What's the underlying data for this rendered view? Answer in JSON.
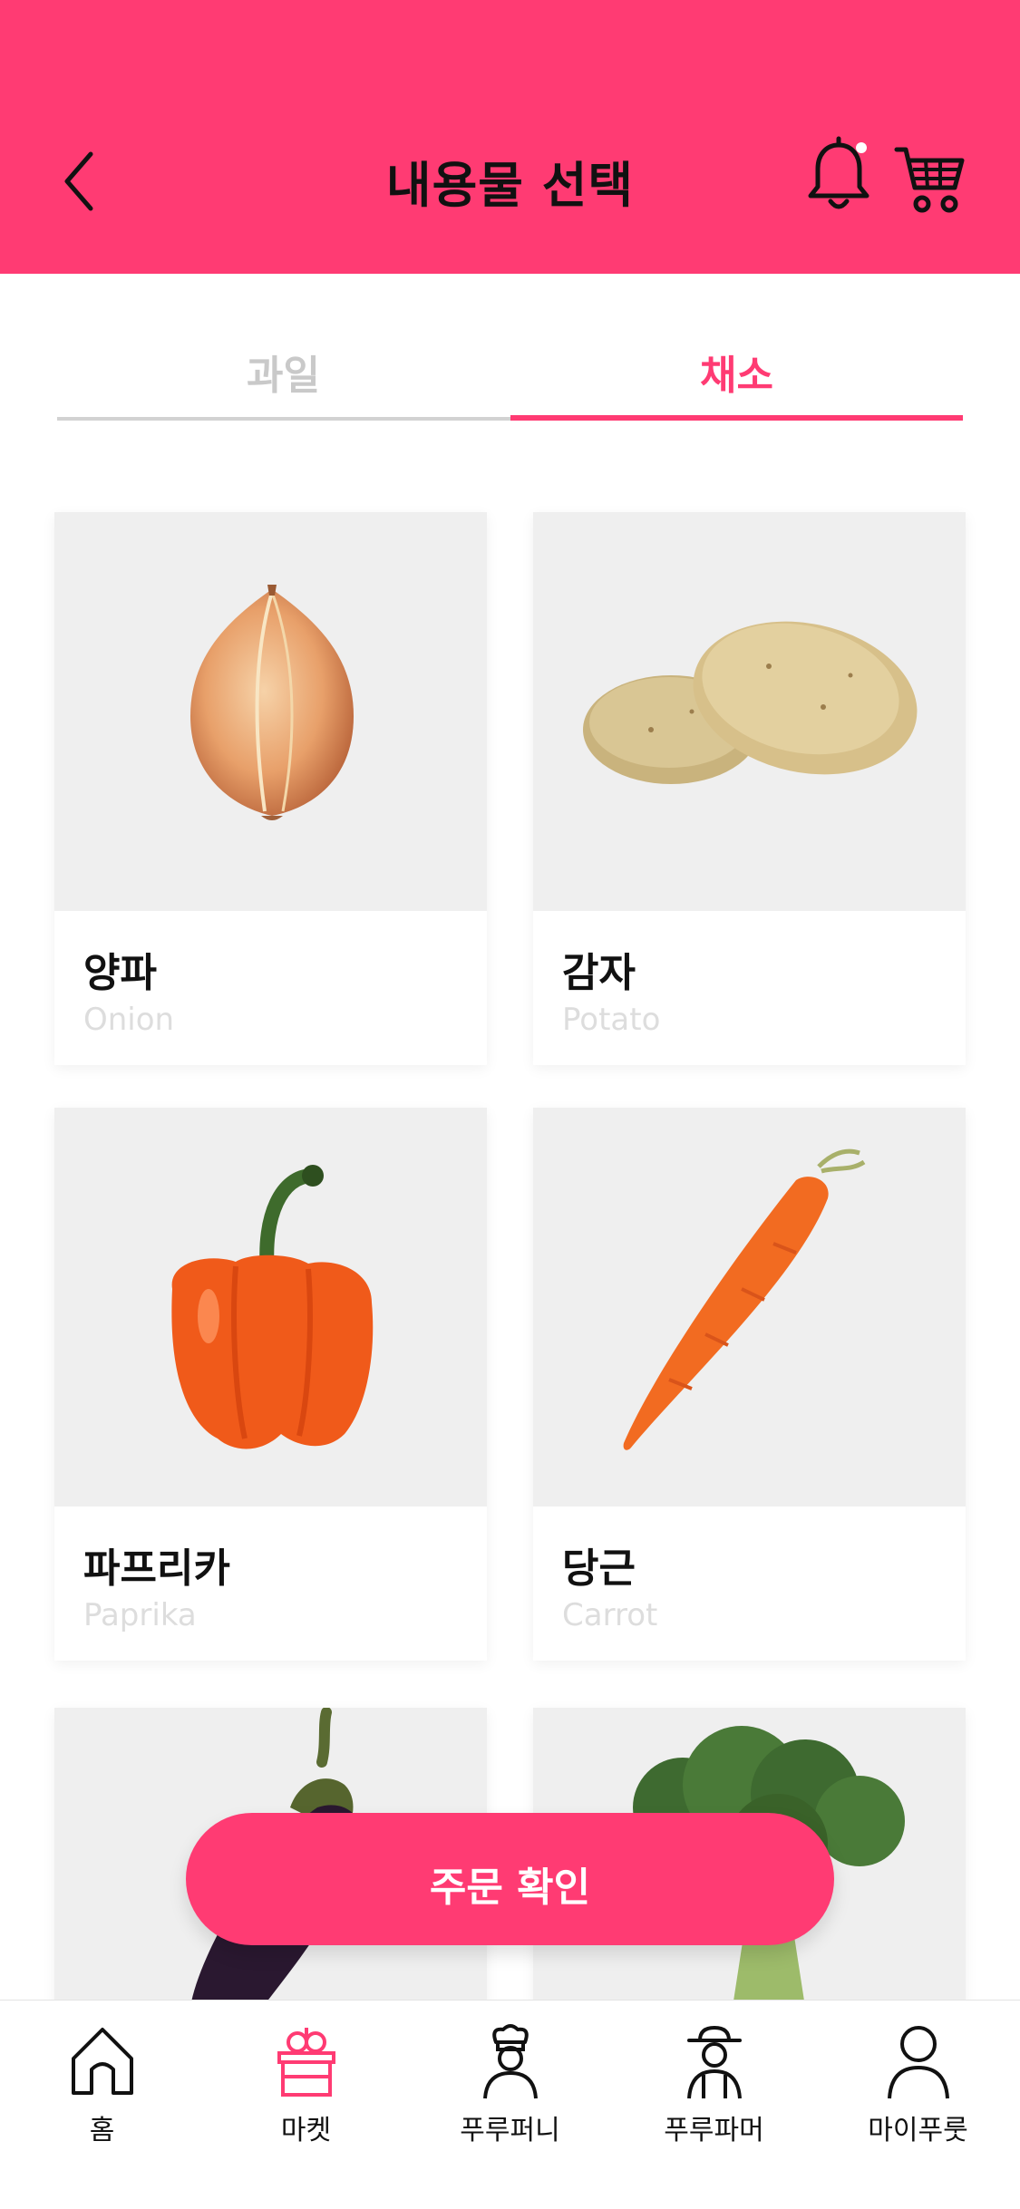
{
  "header": {
    "title": "내용물 선택",
    "background": "#FF3B73",
    "back_icon": "chevron-left-icon",
    "bell_icon": "bell-icon",
    "cart_icon": "cart-icon"
  },
  "tabs": [
    {
      "label": "과일",
      "active": false
    },
    {
      "label": "채소",
      "active": true
    }
  ],
  "products": [
    {
      "name": "양파",
      "english": "Onion",
      "image": "onion"
    },
    {
      "name": "감자",
      "english": "Potato",
      "image": "potato"
    },
    {
      "name": "파프리카",
      "english": "Paprika",
      "image": "paprika"
    },
    {
      "name": "당근",
      "english": "Carrot",
      "image": "carrot"
    },
    {
      "name": "",
      "english": "",
      "image": "eggplant"
    },
    {
      "name": "",
      "english": "",
      "image": "broccoli"
    }
  ],
  "order_button": {
    "label": "주문 확인"
  },
  "bottom_nav": [
    {
      "label": "홈",
      "icon": "home-icon",
      "active": false
    },
    {
      "label": "마켓",
      "icon": "market-basket-icon",
      "active": true
    },
    {
      "label": "푸루퍼니",
      "icon": "chef-icon",
      "active": false
    },
    {
      "label": "푸루파머",
      "icon": "farmer-icon",
      "active": false
    },
    {
      "label": "마이푸룻",
      "icon": "user-icon",
      "active": false
    }
  ],
  "colors": {
    "accent": "#FF3B73",
    "inactive_tab": "#C9C9C9",
    "card_image_bg": "#EFEFEF"
  }
}
